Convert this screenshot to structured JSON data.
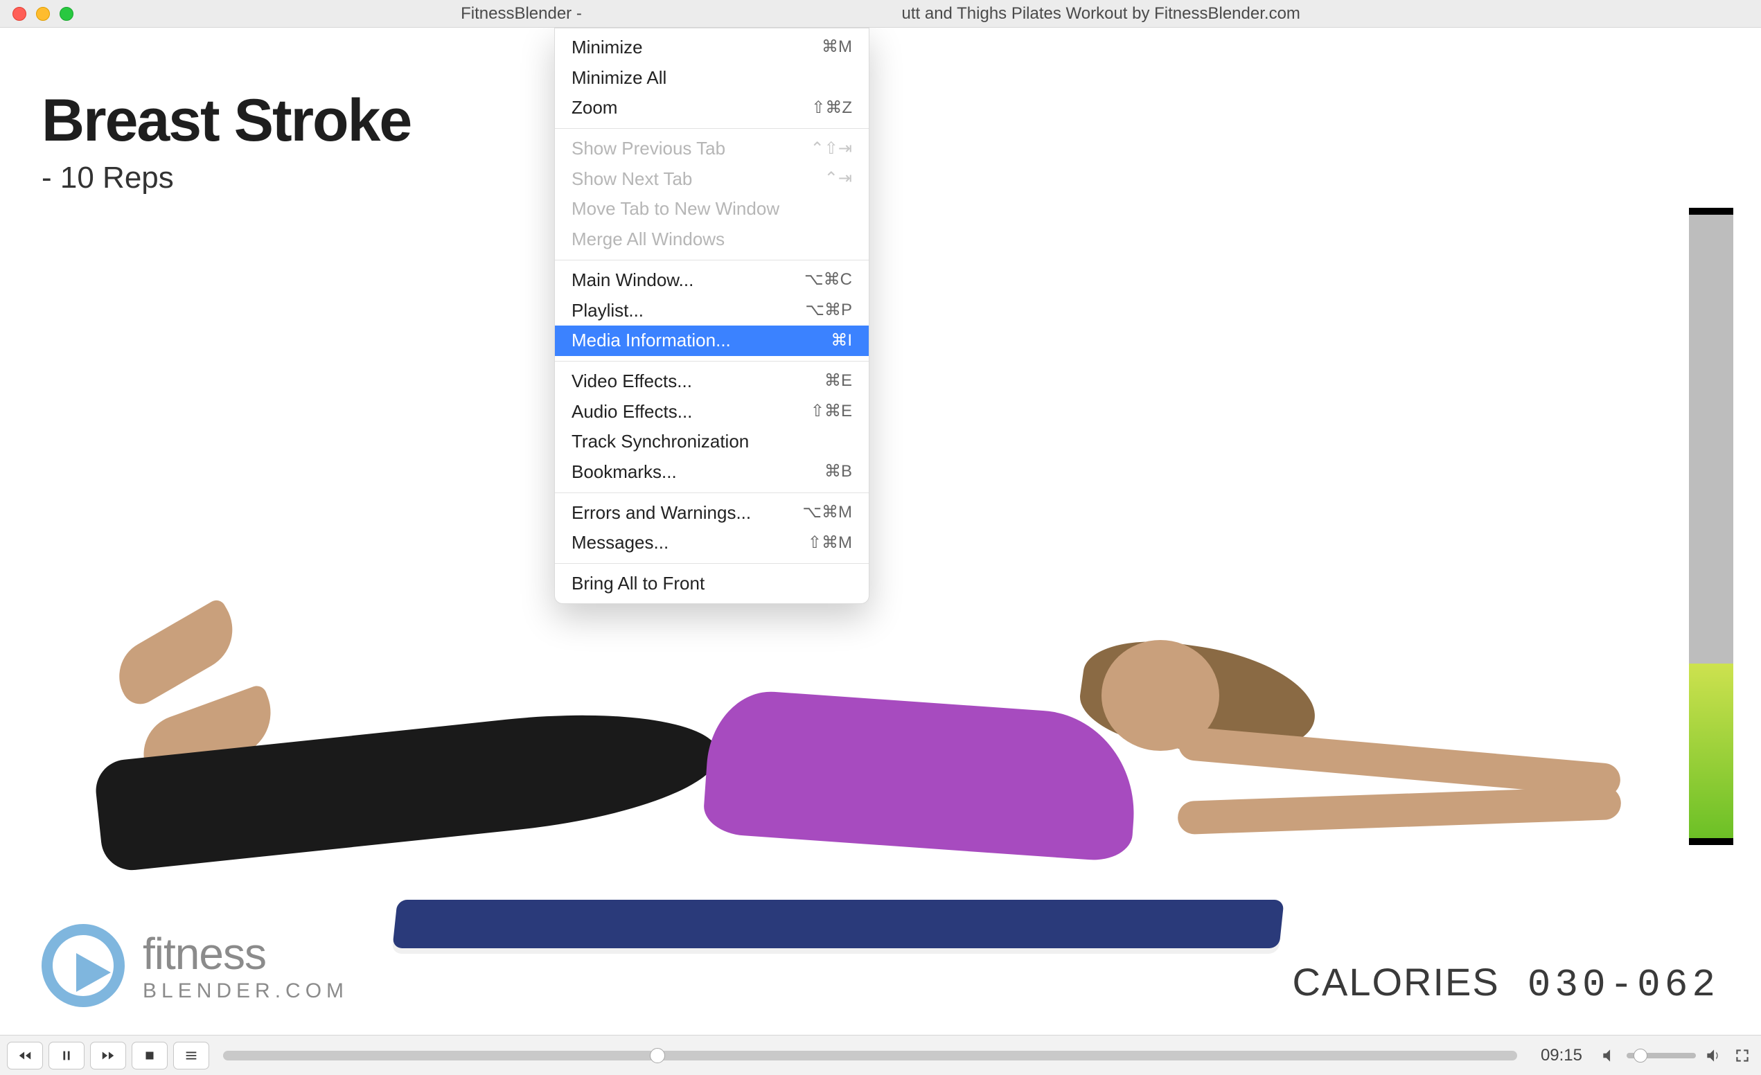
{
  "window": {
    "title_left": "FitnessBlender - ",
    "title_right": "utt and Thighs Pilates Workout by FitnessBlender.com"
  },
  "overlay": {
    "exercise_name": "Breast Stroke",
    "reps": "- 10 Reps"
  },
  "brand": {
    "line1": "fitness",
    "line2": "BLENDER.COM"
  },
  "calories": {
    "label": "CALORIES",
    "value": "030-062"
  },
  "intensity": {
    "fill_percent": 28
  },
  "menu": {
    "groups": [
      [
        {
          "label": "Minimize",
          "shortcut": "⌘M",
          "enabled": true
        },
        {
          "label": "Minimize All",
          "shortcut": "",
          "enabled": true
        },
        {
          "label": "Zoom",
          "shortcut": "⇧⌘Z",
          "enabled": true
        }
      ],
      [
        {
          "label": "Show Previous Tab",
          "shortcut": "⌃⇧⇥",
          "enabled": false
        },
        {
          "label": "Show Next Tab",
          "shortcut": "⌃⇥",
          "enabled": false
        },
        {
          "label": "Move Tab to New Window",
          "shortcut": "",
          "enabled": false
        },
        {
          "label": "Merge All Windows",
          "shortcut": "",
          "enabled": false
        }
      ],
      [
        {
          "label": "Main Window...",
          "shortcut": "⌥⌘C",
          "enabled": true
        },
        {
          "label": "Playlist...",
          "shortcut": "⌥⌘P",
          "enabled": true
        },
        {
          "label": "Media Information...",
          "shortcut": "⌘I",
          "enabled": true,
          "highlighted": true
        }
      ],
      [
        {
          "label": "Video Effects...",
          "shortcut": "⌘E",
          "enabled": true
        },
        {
          "label": "Audio Effects...",
          "shortcut": "⇧⌘E",
          "enabled": true
        },
        {
          "label": "Track Synchronization",
          "shortcut": "",
          "enabled": true
        },
        {
          "label": "Bookmarks...",
          "shortcut": "⌘B",
          "enabled": true
        }
      ],
      [
        {
          "label": "Errors and Warnings...",
          "shortcut": "⌥⌘M",
          "enabled": true
        },
        {
          "label": "Messages...",
          "shortcut": "⇧⌘M",
          "enabled": true
        }
      ],
      [
        {
          "label": "Bring All to Front",
          "shortcut": "",
          "enabled": true
        }
      ]
    ]
  },
  "player": {
    "time": "09:15",
    "seek_percent": 33,
    "volume_percent": 10
  }
}
